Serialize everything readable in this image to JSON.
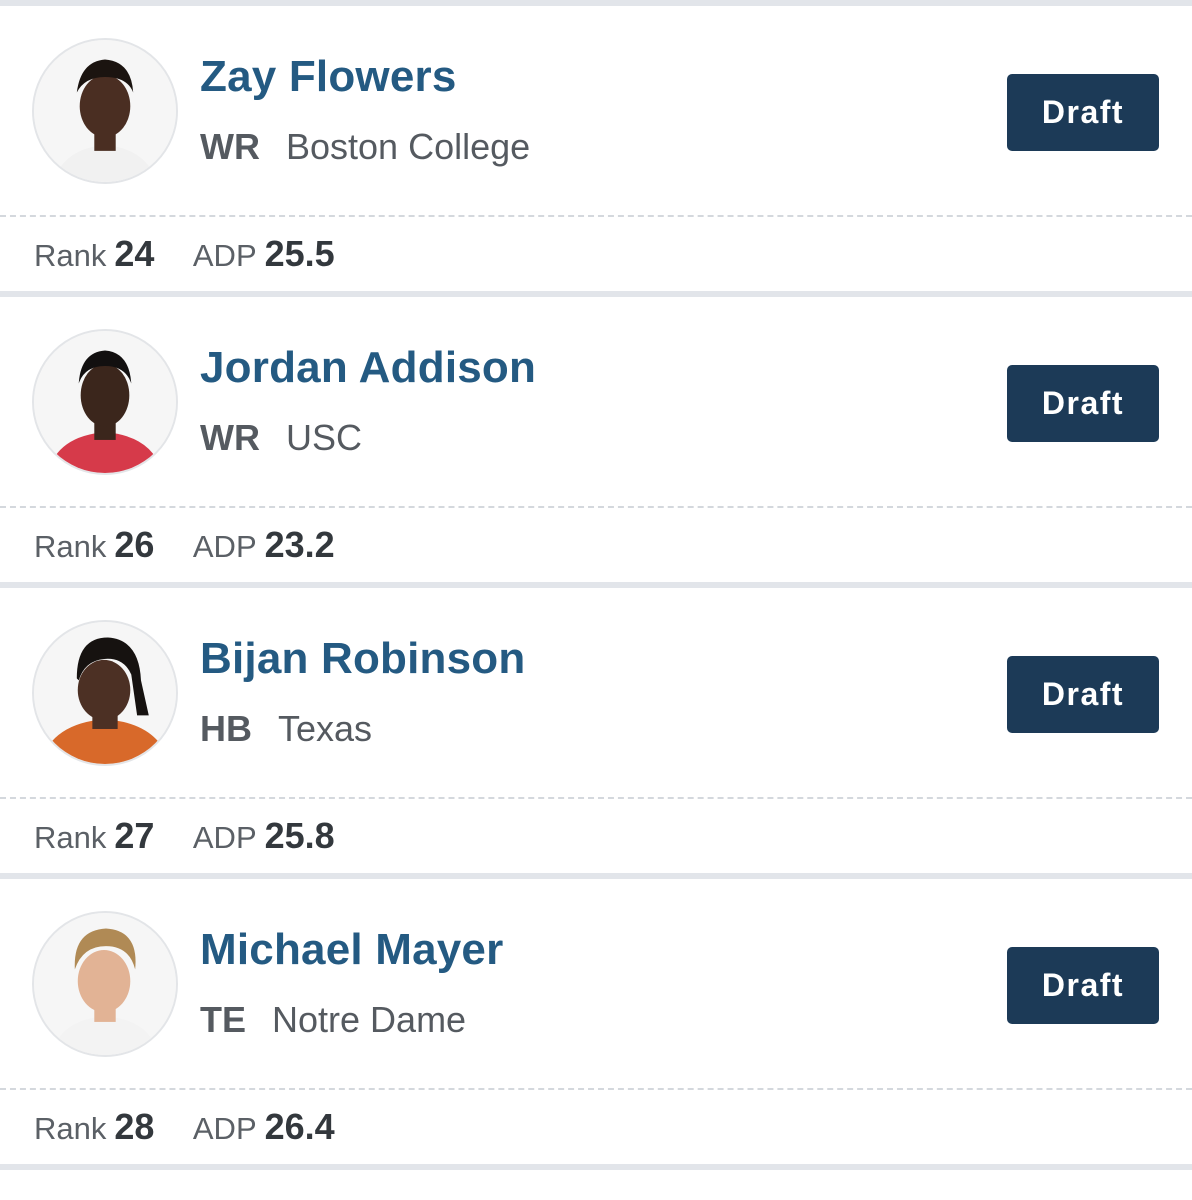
{
  "draft_board": {
    "players": [
      {
        "name": "Zay Flowers",
        "position": "WR",
        "school": "Boston College",
        "rank_label": "Rank",
        "rank": "24",
        "adp_label": "ADP",
        "adp": "25.5",
        "draft_label": "Draft",
        "jersey_color": "#f1f1f1",
        "skin_color": "#4a2e22",
        "hair_color": "#1b1410"
      },
      {
        "name": "Jordan Addison",
        "position": "WR",
        "school": "USC",
        "rank_label": "Rank",
        "rank": "26",
        "adp_label": "ADP",
        "adp": "23.2",
        "draft_label": "Draft",
        "jersey_color": "#d63a4a",
        "skin_color": "#3b261c",
        "hair_color": "#121010"
      },
      {
        "name": "Bijan Robinson",
        "position": "HB",
        "school": "Texas",
        "rank_label": "Rank",
        "rank": "27",
        "adp_label": "ADP",
        "adp": "25.8",
        "draft_label": "Draft",
        "jersey_color": "#d8692a",
        "skin_color": "#4c3024",
        "hair_color": "#161210"
      },
      {
        "name": "Michael Mayer",
        "position": "TE",
        "school": "Notre Dame",
        "rank_label": "Rank",
        "rank": "28",
        "adp_label": "ADP",
        "adp": "26.4",
        "draft_label": "Draft",
        "jersey_color": "#f3f3f3",
        "skin_color": "#e2b395",
        "hair_color": "#b08a55"
      }
    ]
  },
  "colors": {
    "name_blue": "#245a82",
    "button_navy": "#1c3a57",
    "divider": "#e2e5ea"
  }
}
